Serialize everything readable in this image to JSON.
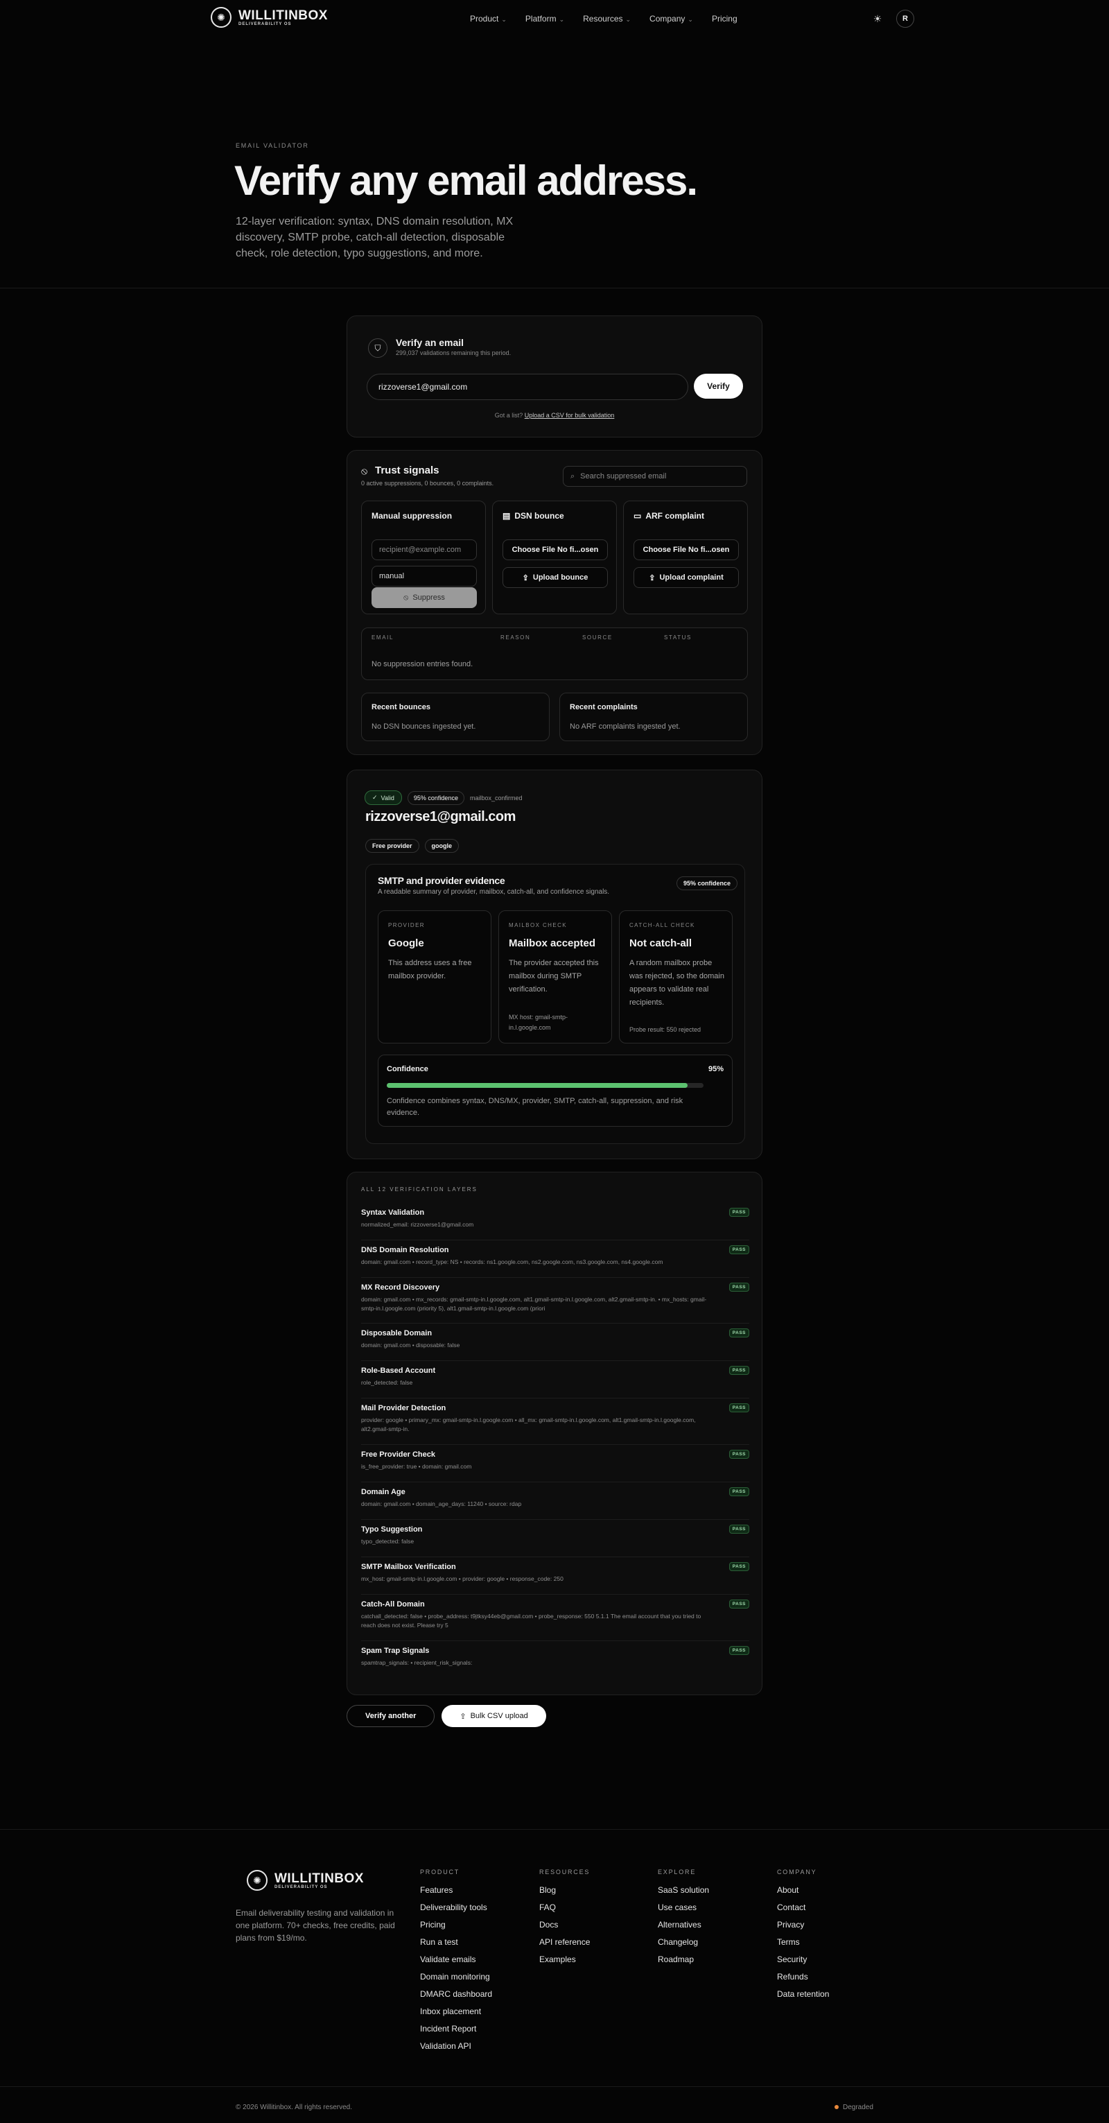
{
  "brand": {
    "name": "WILLITINBOX",
    "tagline": "DELIVERABILITY OS"
  },
  "nav": {
    "items": [
      "Product",
      "Platform",
      "Resources",
      "Company",
      "Pricing"
    ],
    "avatar": "R"
  },
  "hero": {
    "eyebrow": "EMAIL VALIDATOR",
    "title": "Verify any email address.",
    "subtitle": "12-layer verification: syntax, DNS domain resolution, MX discovery, SMTP probe, catch-all detection, disposable check, role detection, typo suggestions, and more."
  },
  "verify": {
    "title": "Verify an email",
    "subtitle": "299,037 validations remaining this period.",
    "input_value": "rizzoverse1@gmail.com",
    "button": "Verify",
    "bulk_prefix": "Got a list?",
    "bulk_link": "Upload a CSV for bulk validation"
  },
  "trust": {
    "title": "Trust signals",
    "subtitle": "0 active suppressions, 0 bounces, 0 complaints.",
    "search_placeholder": "Search suppressed email",
    "manual": {
      "title": "Manual suppression",
      "recipient_placeholder": "recipient@example.com",
      "reason_value": "manual",
      "button": "Suppress"
    },
    "dsn": {
      "title": "DSN bounce",
      "file": "Choose File No fi...osen",
      "button": "Upload bounce"
    },
    "arf": {
      "title": "ARF complaint",
      "file": "Choose File No fi...osen",
      "button": "Upload complaint"
    },
    "table": {
      "columns": [
        "EMAIL",
        "REASON",
        "SOURCE",
        "STATUS"
      ],
      "empty": "No suppression entries found."
    },
    "recent_bounces": {
      "title": "Recent bounces",
      "empty": "No DSN bounces ingested yet."
    },
    "recent_complaints": {
      "title": "Recent complaints",
      "empty": "No ARF complaints ingested yet."
    }
  },
  "result": {
    "status": "Valid",
    "confidence_badge": "95% confidence",
    "code": "mailbox_confirmed",
    "email": "rizzoverse1@gmail.com",
    "chips": [
      "Free provider",
      "google"
    ],
    "evidence": {
      "title": "SMTP and provider evidence",
      "subtitle": "A readable summary of provider, mailbox, catch-all, and confidence signals.",
      "confidence_badge": "95% confidence",
      "cols": [
        {
          "label": "PROVIDER",
          "value": "Google",
          "desc": "This address uses a free mailbox provider.",
          "foot": ""
        },
        {
          "label": "MAILBOX CHECK",
          "value": "Mailbox accepted",
          "desc": "The provider accepted this mailbox during SMTP verification.",
          "foot": "MX host: gmail-smtp-in.l.google.com"
        },
        {
          "label": "CATCH-ALL CHECK",
          "value": "Not catch-all",
          "desc": "A random mailbox probe was rejected, so the domain appears to validate real recipients.",
          "foot": "Probe result: 550 rejected"
        }
      ],
      "confidence": {
        "label": "Confidence",
        "value_text": "95%",
        "value": 95,
        "desc": "Confidence combines syntax, DNS/MX, provider, SMTP, catch-all, suppression, and risk evidence."
      }
    }
  },
  "layers": {
    "header": "ALL 12 VERIFICATION LAYERS",
    "badge": "PASS",
    "items": [
      {
        "name": "Syntax Validation",
        "detail": "normalized_email: rizzoverse1@gmail.com"
      },
      {
        "name": "DNS Domain Resolution",
        "detail": "domain: gmail.com • record_type: NS • records: ns1.google.com, ns2.google.com, ns3.google.com, ns4.google.com"
      },
      {
        "name": "MX Record Discovery",
        "detail": "domain: gmail.com • mx_records: gmail-smtp-in.l.google.com, alt1.gmail-smtp-in.l.google.com, alt2.gmail-smtp-in. • mx_hosts: gmail-smtp-in.l.google.com (priority 5), alt1.gmail-smtp-in.l.google.com (priori"
      },
      {
        "name": "Disposable Domain",
        "detail": "domain: gmail.com • disposable: false"
      },
      {
        "name": "Role-Based Account",
        "detail": "role_detected: false"
      },
      {
        "name": "Mail Provider Detection",
        "detail": "provider: google • primary_mx: gmail-smtp-in.l.google.com • all_mx: gmail-smtp-in.l.google.com, alt1.gmail-smtp-in.l.google.com, alt2.gmail-smtp-in."
      },
      {
        "name": "Free Provider Check",
        "detail": "is_free_provider: true • domain: gmail.com"
      },
      {
        "name": "Domain Age",
        "detail": "domain: gmail.com • domain_age_days: 11240 • source: rdap"
      },
      {
        "name": "Typo Suggestion",
        "detail": "typo_detected: false"
      },
      {
        "name": "SMTP Mailbox Verification",
        "detail": "mx_host: gmail-smtp-in.l.google.com • provider: google • response_code: 250"
      },
      {
        "name": "Catch-All Domain",
        "detail": "catchall_detected: false • probe_address: t9jtksy44eb@gmail.com • probe_response: 550 5.1.1 The email account that you tried to reach does not exist. Please try 5"
      },
      {
        "name": "Spam Trap Signals",
        "detail": "spamtrap_signals: • recipient_risk_signals:"
      }
    ]
  },
  "actions": {
    "verify_another": "Verify another",
    "bulk": "Bulk CSV upload"
  },
  "footer": {
    "desc": "Email deliverability testing and validation in one platform. 70+ checks, free credits, paid plans from $19/mo.",
    "columns": [
      {
        "title": "PRODUCT",
        "links": [
          "Features",
          "Deliverability tools",
          "Pricing",
          "Run a test",
          "Validate emails",
          "Domain monitoring",
          "DMARC dashboard",
          "Inbox placement",
          "Incident Report",
          "Validation API"
        ]
      },
      {
        "title": "RESOURCES",
        "links": [
          "Blog",
          "FAQ",
          "Docs",
          "API reference",
          "Examples"
        ]
      },
      {
        "title": "EXPLORE",
        "links": [
          "SaaS solution",
          "Use cases",
          "Alternatives",
          "Changelog",
          "Roadmap"
        ]
      },
      {
        "title": "COMPANY",
        "links": [
          "About",
          "Contact",
          "Privacy",
          "Terms",
          "Security",
          "Refunds",
          "Data retention"
        ]
      }
    ],
    "copyright": "© 2026 Willitinbox. All rights reserved.",
    "status": "Degraded"
  },
  "colors": {
    "accent_green": "#5cc16f",
    "status_orange": "#e8893c",
    "background": "#050505"
  }
}
